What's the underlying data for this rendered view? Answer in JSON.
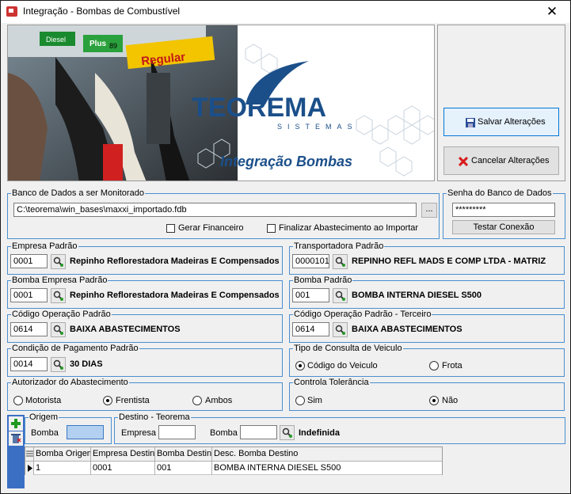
{
  "window": {
    "title": "Integração - Bombas de Combustível",
    "close_glyph": "✕"
  },
  "banner": {
    "pump_labels": [
      "Diesel",
      "Plus",
      "89",
      "Regular"
    ],
    "logo_text": "TEOREMA",
    "logo_sub": "SISTEMAS",
    "caption": "Integração Bombas"
  },
  "buttons": {
    "save_label": "Salvar Alterações",
    "cancel_label": "Cancelar Alterações",
    "browse_label": "...",
    "test_label": "Testar Conexão"
  },
  "database": {
    "legend": "Banco de Dados a ser Monitorado",
    "path": "C:\\teorema\\win_bases\\maxxi_importado.fdb",
    "gerar_financeiro_label": "Gerar Financeiro",
    "finalizar_label": "Finalizar Abastecimento ao Importar"
  },
  "password": {
    "legend": "Senha do Banco de Dados",
    "value": "*********"
  },
  "empresa": {
    "legend": "Empresa Padrão",
    "code": "0001",
    "desc": "Repinho Reflorestadora Madeiras E Compensados"
  },
  "transportadora": {
    "legend": "Transportadora Padrão",
    "code": "0000101",
    "desc": "REPINHO REFL MADS E COMP LTDA - MATRIZ"
  },
  "bomba_empresa": {
    "legend": "Bomba Empresa Padrão",
    "code": "0001",
    "desc": "Repinho Reflorestadora Madeiras E Compensados"
  },
  "bomba": {
    "legend": "Bomba Padrão",
    "code": "001",
    "desc": "BOMBA INTERNA DIESEL S500"
  },
  "codigo_operacao": {
    "legend": "Código Operação Padrão",
    "code": "0614",
    "desc": "BAIXA ABASTECIMENTOS"
  },
  "codigo_operacao_terceiro": {
    "legend": "Código Operação Padrão - Terceiro",
    "code": "0614",
    "desc": "BAIXA ABASTECIMENTOS"
  },
  "condicao": {
    "legend": "Condição de Pagamento Padrão",
    "code": "0014",
    "desc": "30 DIAS"
  },
  "tipo_consulta": {
    "legend": "Tipo de Consulta de Veiculo",
    "options": [
      "Código do Veiculo",
      "Frota"
    ],
    "selected": "Código do Veiculo"
  },
  "autorizador": {
    "legend": "Autorizador do Abastecimento",
    "options": [
      "Motorista",
      "Frentista",
      "Ambos"
    ],
    "selected": "Frentista"
  },
  "tolerancia": {
    "legend": "Controla Tolerância",
    "options": [
      "Sim",
      "Não"
    ],
    "selected": "Não"
  },
  "origem": {
    "legend": "Origem",
    "bomba_label": "Bomba",
    "bomba_value": ""
  },
  "destino": {
    "legend": "Destino - Teorema",
    "empresa_label": "Empresa",
    "empresa_value": "",
    "bomba_label": "Bomba",
    "bomba_value": "",
    "desc": "Indefinida"
  },
  "grid": {
    "columns": [
      "Bomba Origem",
      "Empresa Destino",
      "Bomba Destino",
      "Desc. Bomba Destino"
    ],
    "rows": [
      [
        "1",
        "0001",
        "001",
        "BOMBA INTERNA DIESEL S500"
      ]
    ]
  },
  "icons": {
    "add": "add-icon",
    "delete": "delete-icon",
    "search": "search-icon",
    "save": "save-icon",
    "cancel": "cancel-icon"
  },
  "colors": {
    "group_border": "#4a8fd0",
    "logo_blue": "#1b4f8a",
    "side_bar": "#3b6fc4",
    "focus_input": "#b3d0f0"
  }
}
